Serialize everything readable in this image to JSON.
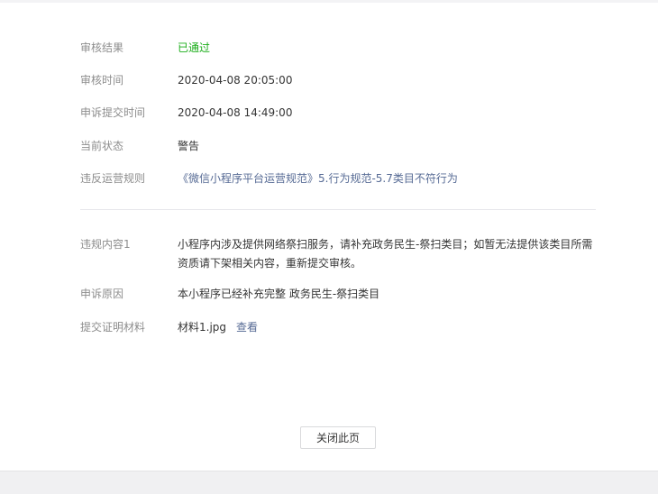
{
  "review": {
    "result": {
      "label": "审核结果",
      "value": "已通过"
    },
    "review_time": {
      "label": "审核时间",
      "value": "2020-04-08 20:05:00"
    },
    "appeal_time": {
      "label": "申诉提交时间",
      "value": "2020-04-08 14:49:00"
    },
    "current_status": {
      "label": "当前状态",
      "value": "警告"
    },
    "violated_rule": {
      "label": "违反运营规则",
      "value": "《微信小程序平台运营规范》5.行为规范-5.7类目不符行为"
    }
  },
  "details": {
    "violation_content": {
      "label": "违规内容1",
      "value": "小程序内涉及提供网络祭扫服务，请补充政务民生-祭扫类目；如暂无法提供该类目所需资质请下架相关内容，重新提交审核。"
    },
    "appeal_reason": {
      "label": "申诉原因",
      "value": "本小程序已经补充完整 政务民生-祭扫类目"
    },
    "evidence": {
      "label": "提交证明材料",
      "file_name": "材料1.jpg",
      "view_label": "查看"
    }
  },
  "footer": {
    "close_label": "关闭此页"
  },
  "colors": {
    "success": "#1aad19",
    "link": "#576b95",
    "label": "#8d8d8d",
    "text": "#353535"
  }
}
